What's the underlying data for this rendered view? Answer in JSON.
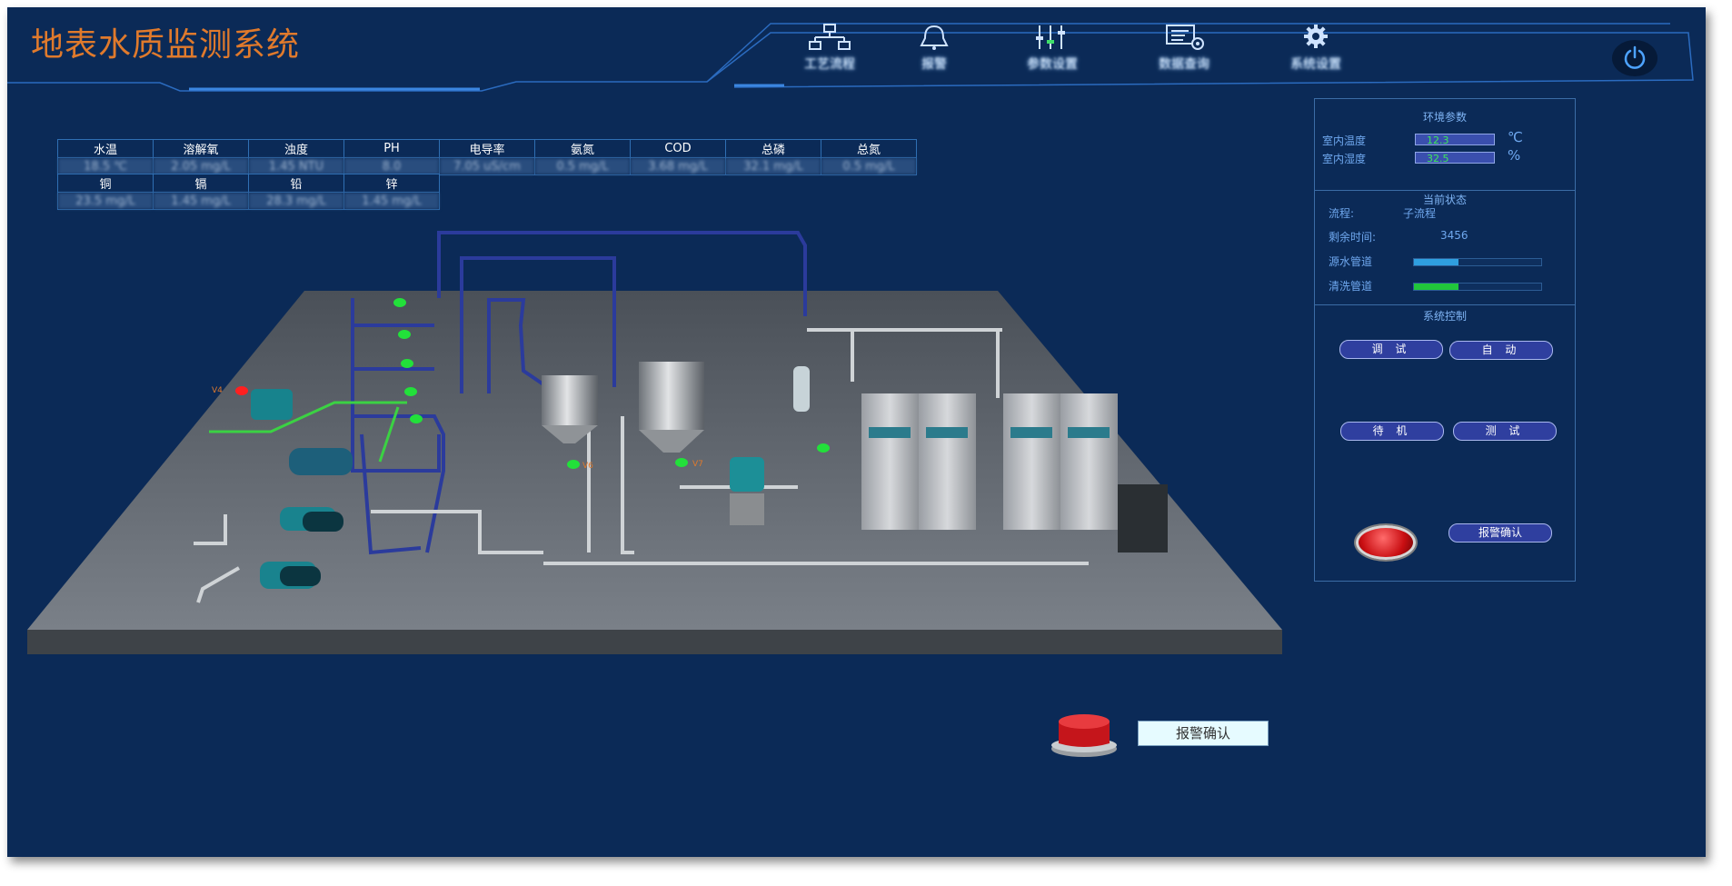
{
  "app": {
    "title": "地表水质监测系统"
  },
  "nav": {
    "items": [
      {
        "label": "工艺流程",
        "icon": "process-flow-icon"
      },
      {
        "label": "报警",
        "icon": "bell-icon"
      },
      {
        "label": "参数设置",
        "icon": "sliders-icon"
      },
      {
        "label": "数据查询",
        "icon": "data-settings-icon"
      },
      {
        "label": "系统设置",
        "icon": "gear-icon"
      }
    ],
    "power_icon": "power-icon"
  },
  "measurements": {
    "row1_headers": [
      "水温",
      "溶解氧",
      "浊度",
      "PH",
      "电导率",
      "氨氮",
      "COD",
      "总磷",
      "总氮"
    ],
    "row1_values": [
      "18.5 ℃",
      "2.05 mg/L",
      "1.45 NTU",
      "8.0",
      "7.05 uS/cm",
      "0.5 mg/L",
      "3.68 mg/L",
      "32.1 mg/L",
      "0.5 mg/L"
    ],
    "row2_headers": [
      "铜",
      "镉",
      "铅",
      "锌"
    ],
    "row2_values": [
      "23.5 mg/L",
      "1.45 mg/L",
      "28.3 mg/L",
      "1.45 mg/L"
    ]
  },
  "panel": {
    "env_title": "环境参数",
    "indoor_temp_label": "室内温度",
    "indoor_temp_value": "12.3",
    "indoor_temp_unit": "℃",
    "indoor_humidity_label": "室内湿度",
    "indoor_humidity_value": "32.5",
    "indoor_humidity_unit": "%",
    "status_title": "当前状态",
    "flow_label": "流程:",
    "flow_value": "子流程",
    "remaining_label": "剩余时间:",
    "remaining_value": "3456",
    "source_pipe_label": "源水管道",
    "source_pipe_progress": 0.35,
    "clean_pipe_label": "清洗管道",
    "clean_pipe_progress": 0.35,
    "control_title": "系统控制",
    "buttons": {
      "debug": "调 试",
      "auto": "自 动",
      "standby": "待 机",
      "test": "测 试"
    },
    "alarm_ack": "报警确认"
  },
  "bottom": {
    "alarm_ack": "报警确认"
  },
  "valves": {
    "v4": "V4",
    "v6": "V6",
    "v7": "V7"
  },
  "colors": {
    "background": "#0b2a57",
    "title": "#e07a2c",
    "source_pipe_bar": "#2f9fe0",
    "clean_pipe_bar": "#21c63b",
    "alarm": "#d0141a"
  }
}
